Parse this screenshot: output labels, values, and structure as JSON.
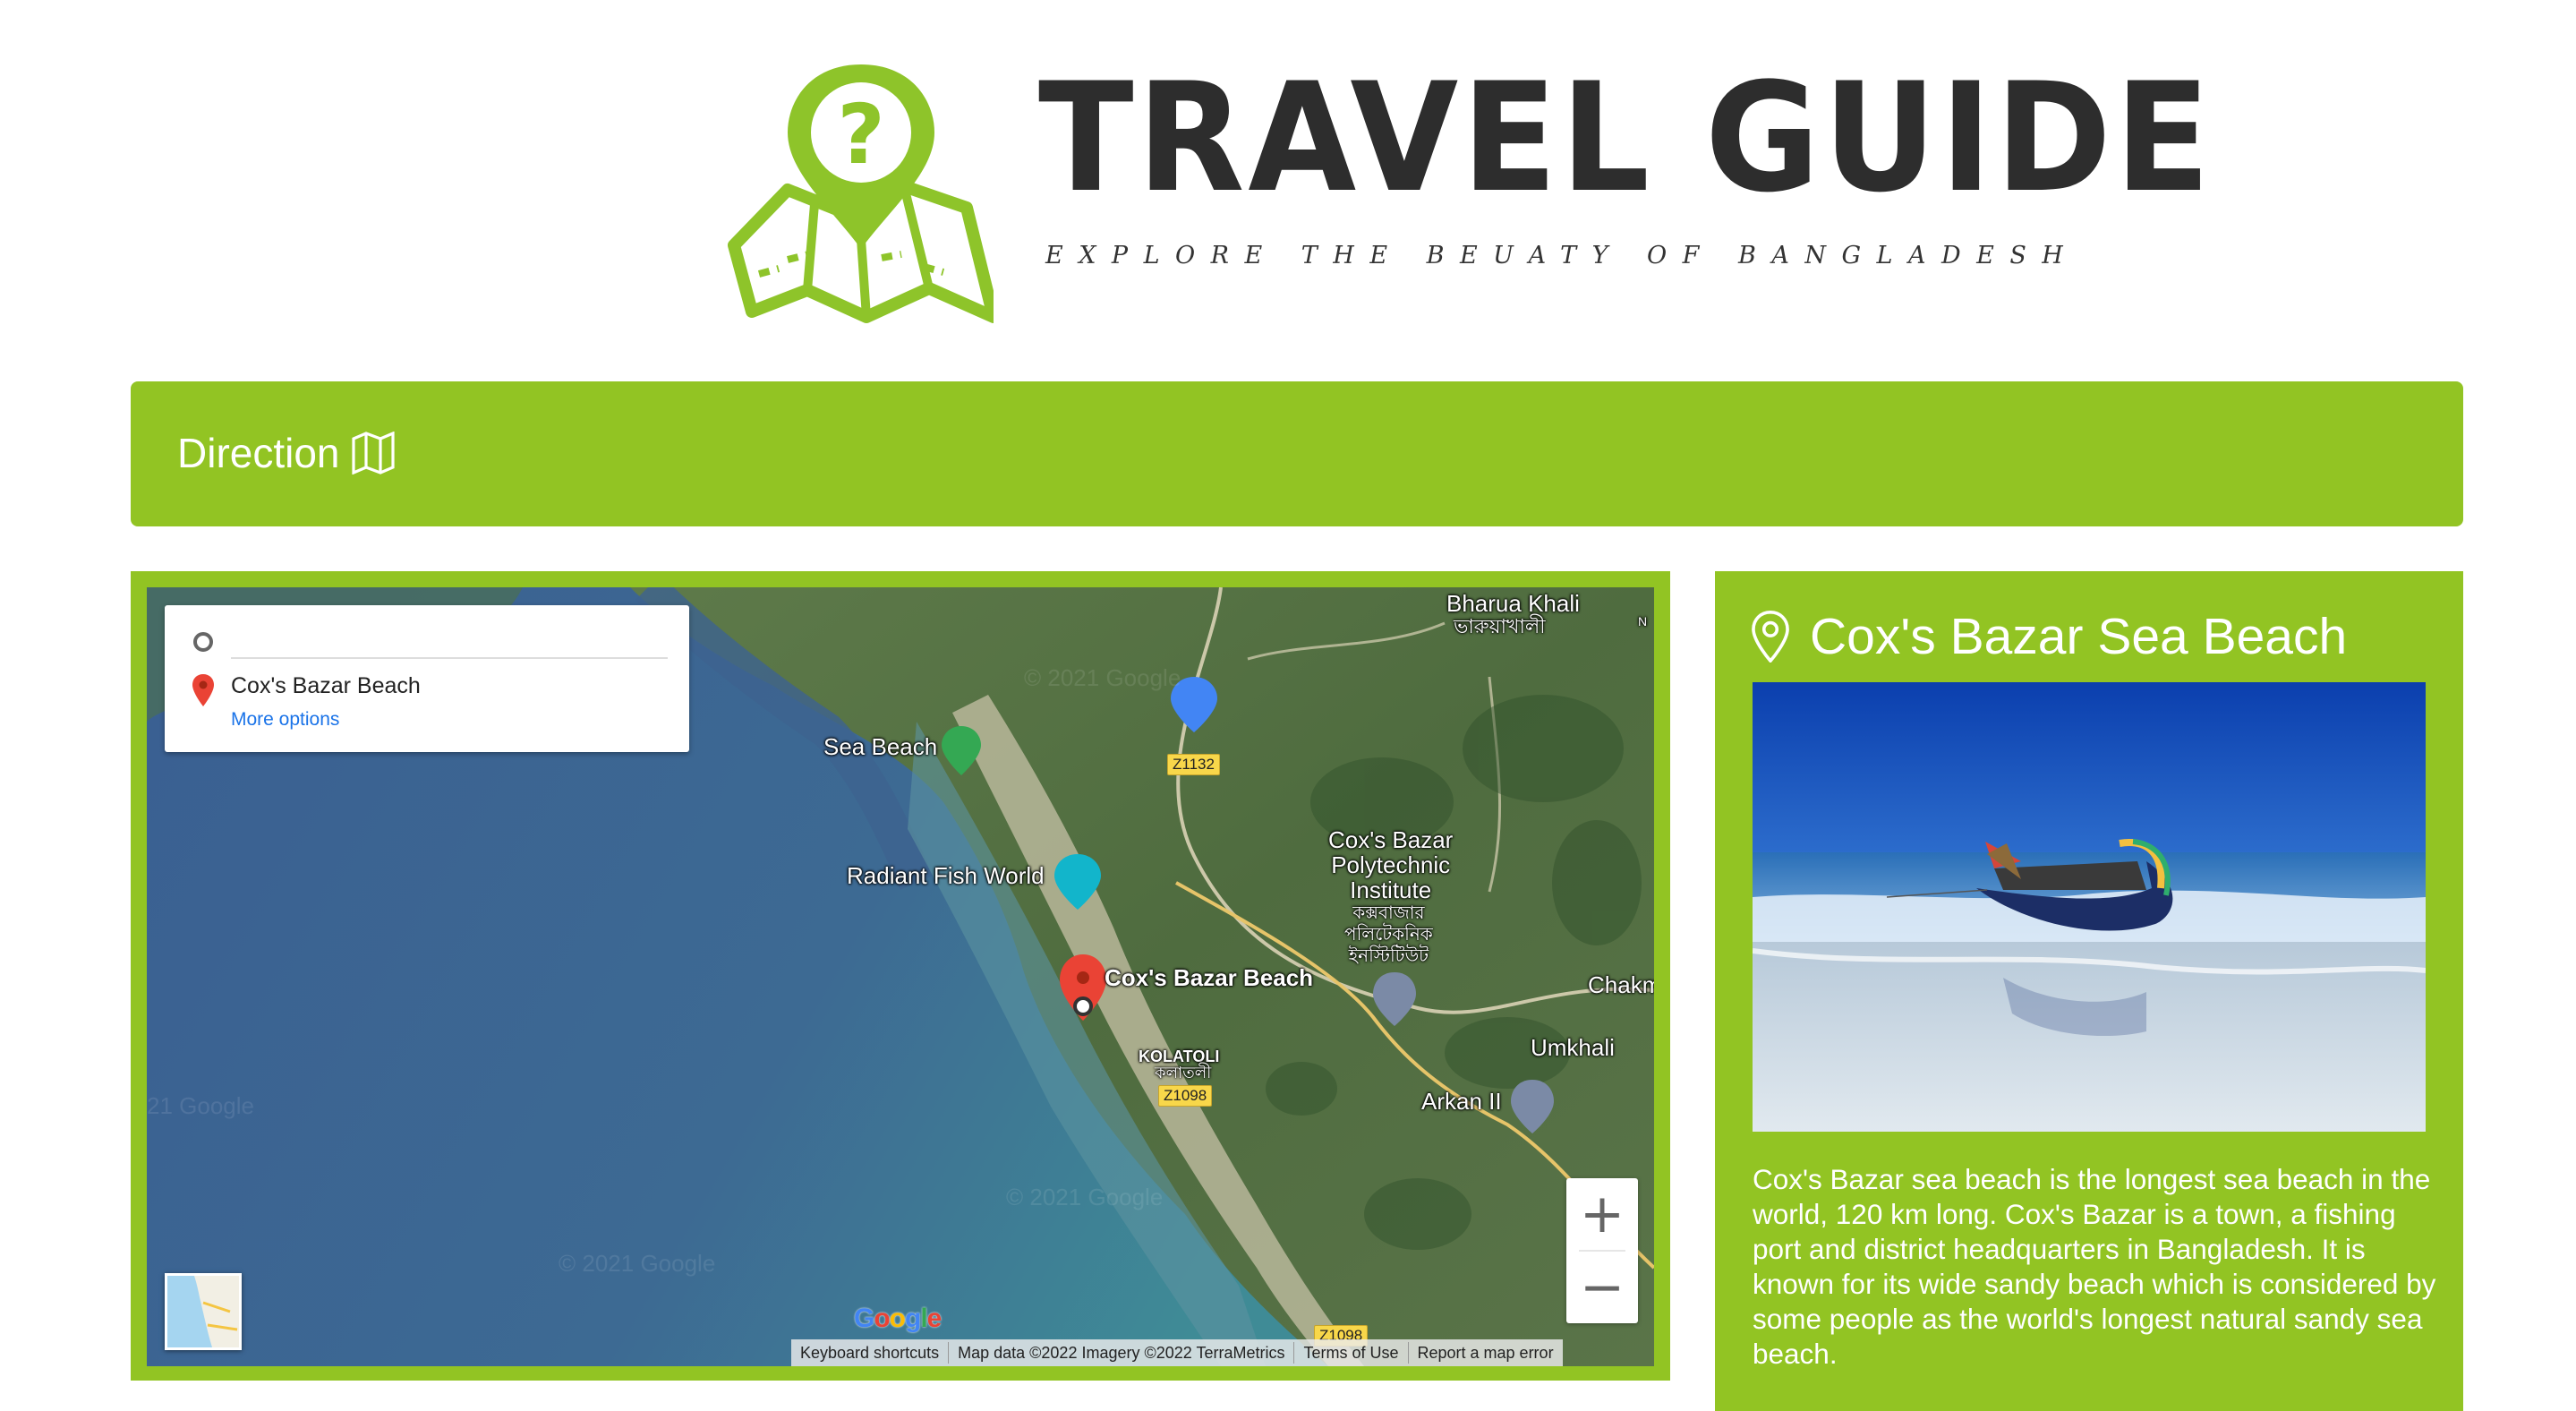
{
  "header": {
    "brand_title": "TRAVEL GUIDE",
    "brand_tagline": "EXPLORE THE BEUATY OF BANGLADESH",
    "logo_icon": "map-question-pin-icon",
    "accent_color": "#92c423"
  },
  "direction": {
    "title": "Direction",
    "icon": "map-icon"
  },
  "map": {
    "directions_card": {
      "origin_value": "",
      "destination_value": "Cox's Bazar Beach",
      "more_options_label": "More options"
    },
    "places": {
      "bharua_khali_en": "Bharua Khali",
      "bharua_khali_bn": "ভারুয়াখালী",
      "sea_beach": "Sea Beach",
      "radiant_fish_world": "Radiant Fish World",
      "polytechnic_en": "Cox's Bazar\nPolytechnic\nInstitute",
      "polytechnic_bn": "কক্সবাজার\nপলিটেকনিক\nইনস্টিটিউট",
      "coxs_bazar_beach": "Cox's Bazar Beach",
      "chakm": "Chakm",
      "umkhali": "Umkhali",
      "kolatoli_en": "KOLATOLI",
      "kolatoli_bn": "কলাতলী",
      "arkan_ii": "Arkan II",
      "north_edge": "N"
    },
    "road_badges": {
      "z1132": "Z1132",
      "z1098": "Z1098",
      "z1098_bottom": "Z1098"
    },
    "watermarks": [
      "© 2021 Google",
      "© 2021 Google",
      "© 2021 Google",
      "21 Google"
    ],
    "zoom_in_label": "+",
    "zoom_out_label": "−",
    "google_logo": "Google",
    "attribution": {
      "keyboard_shortcuts": "Keyboard shortcuts",
      "map_data": "Map data ©2022 Imagery ©2022 TerraMetrics",
      "terms": "Terms of Use",
      "report": "Report a map error"
    }
  },
  "info": {
    "title": "Cox's Bazar Sea Beach",
    "title_icon": "location-pin-outline-icon",
    "photo_subject": "boat-on-beach-photo",
    "description": "Cox's Bazar sea beach is the longest sea beach in the world, 120 km long. Cox's Bazar is a town, a fishing port and district headquarters in Bangladesh. It is known for its wide sandy beach which is considered by some people as the world's longest natural sandy sea beach."
  }
}
